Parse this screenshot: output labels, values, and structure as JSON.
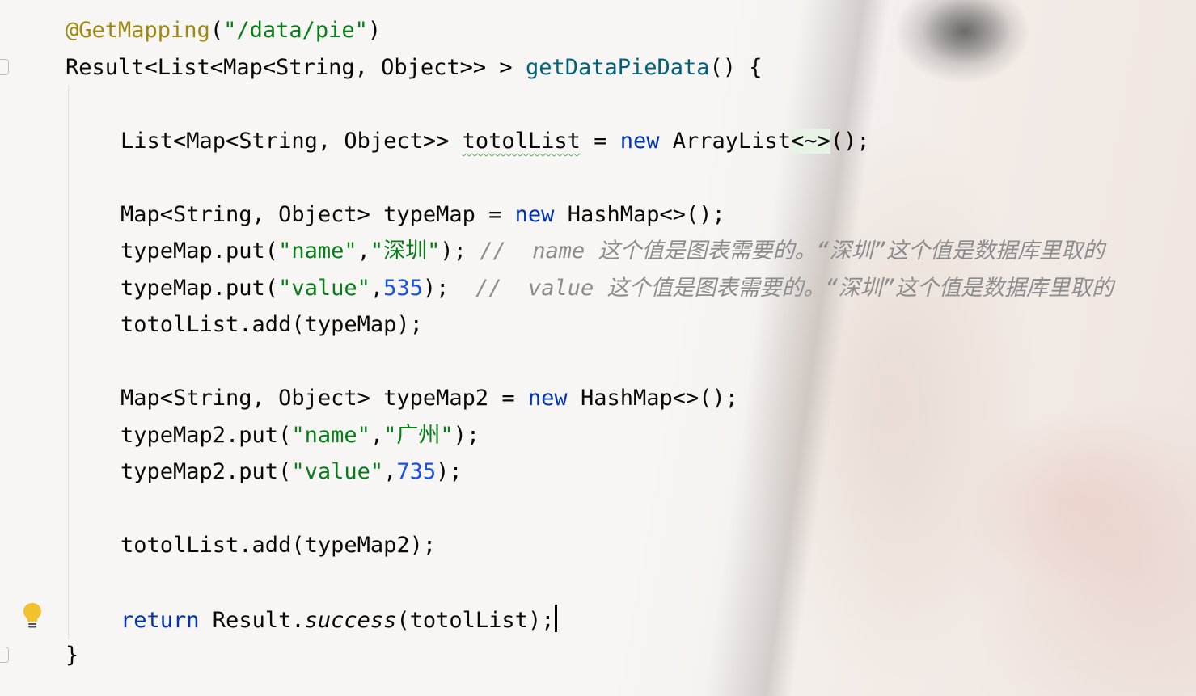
{
  "editor": {
    "lines": {
      "annotation": {
        "name": "@GetMapping",
        "open": "(",
        "path": "\"/data/pie\"",
        "close": ")"
      },
      "signature": {
        "prefix": "Result<List<Map<String, Object>> > ",
        "method": "getDataPieData",
        "suffix": "() {"
      },
      "totol_decl": {
        "a": "List<Map<String, Object>> ",
        "var": "totolList",
        "b": " = ",
        "new": "new",
        "c": " ArrayList",
        "diamond": "<~>",
        "d": "();"
      },
      "typemap_decl": {
        "a": "Map<String, Object> typeMap = ",
        "new": "new",
        "b": " HashMap<>();"
      },
      "put_name1": {
        "a": "typeMap.put(",
        "key": "\"name\"",
        "comma": ",",
        "val": "\"深圳\"",
        "end": "); ",
        "comment": "//  name 这个值是图表需要的。“深圳”这个值是数据库里取的"
      },
      "put_value1": {
        "a": "typeMap.put(",
        "key": "\"value\"",
        "comma": ",",
        "num": "535",
        "end": ");  ",
        "comment": "//  value 这个值是图表需要的。“深圳”这个值是数据库里取的"
      },
      "add1": "totolList.add(typeMap);",
      "typemap2_decl": {
        "a": "Map<String, Object> typeMap2 = ",
        "new": "new",
        "b": " HashMap<>();"
      },
      "put_name2": {
        "a": "typeMap2.put(",
        "key": "\"name\"",
        "comma": ",",
        "val": "\"广州\"",
        "end": ");"
      },
      "put_value2": {
        "a": "typeMap2.put(",
        "key": "\"value\"",
        "comma": ",",
        "num": "735",
        "end": ");"
      },
      "add2": "totolList.add(typeMap2);",
      "return_line": {
        "kw": "return",
        "a": " Result.",
        "method": "success",
        "b": "(totolList);"
      },
      "close": "}"
    }
  },
  "icons": {
    "intention": "lightbulb-icon",
    "fold": "fold-marker-icon"
  },
  "colors": {
    "keyword": "#0033b3",
    "string": "#067d17",
    "number": "#1750eb",
    "annotation": "#9e880d",
    "method_decl": "#00627a",
    "comment": "#8c8c8c",
    "bulb": "#f2c12e"
  }
}
